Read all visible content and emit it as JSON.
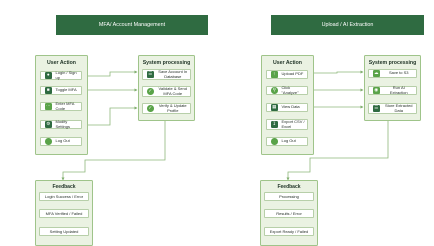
{
  "left": {
    "banner": "MFA/ Account Management",
    "user_action": {
      "title": "User Action",
      "items": [
        {
          "label": "Login / Sign up",
          "icon": "user-icon"
        },
        {
          "label": "Toggle MFA",
          "icon": "toggle-icon"
        },
        {
          "label": "Enter MFA Code",
          "icon": "keyboard-icon"
        },
        {
          "label": "Modify Settings",
          "icon": "settings-icon"
        },
        {
          "label": "Log Out",
          "icon": "logout-icon"
        }
      ]
    },
    "system": {
      "title": "System processing",
      "items": [
        {
          "label": "Save Account In Database",
          "icon": "database-icon"
        },
        {
          "label": "Validate & Send MFA Code",
          "icon": "shield-icon"
        },
        {
          "label": "Verify & Update Profile",
          "icon": "check-icon"
        }
      ]
    },
    "feedback": {
      "title": "Feedback",
      "items": [
        "Login Success / Error",
        "MFA Verified / Failed",
        "Setting Updated"
      ]
    }
  },
  "right": {
    "banner": "Upload / AI Extraction",
    "user_action": {
      "title": "User Action",
      "items": [
        {
          "label": "Upload PDF",
          "icon": "upload-icon"
        },
        {
          "label": "Click \"Analyze\"",
          "icon": "search-icon"
        },
        {
          "label": "View Data",
          "icon": "table-icon"
        },
        {
          "label": "Export CSV / Excel",
          "icon": "export-icon"
        },
        {
          "label": "Log Out",
          "icon": "logout-icon"
        }
      ]
    },
    "system": {
      "title": "System processing",
      "items": [
        {
          "label": "Save to S3",
          "icon": "cloud-icon"
        },
        {
          "label": "Run AI Extraction",
          "icon": "robot-icon"
        },
        {
          "label": "Store Extracted Data",
          "icon": "database-icon"
        }
      ]
    },
    "feedback": {
      "title": "Feedback",
      "items": [
        "Processing",
        "Results / Error",
        "Export Ready / Failed"
      ]
    }
  }
}
